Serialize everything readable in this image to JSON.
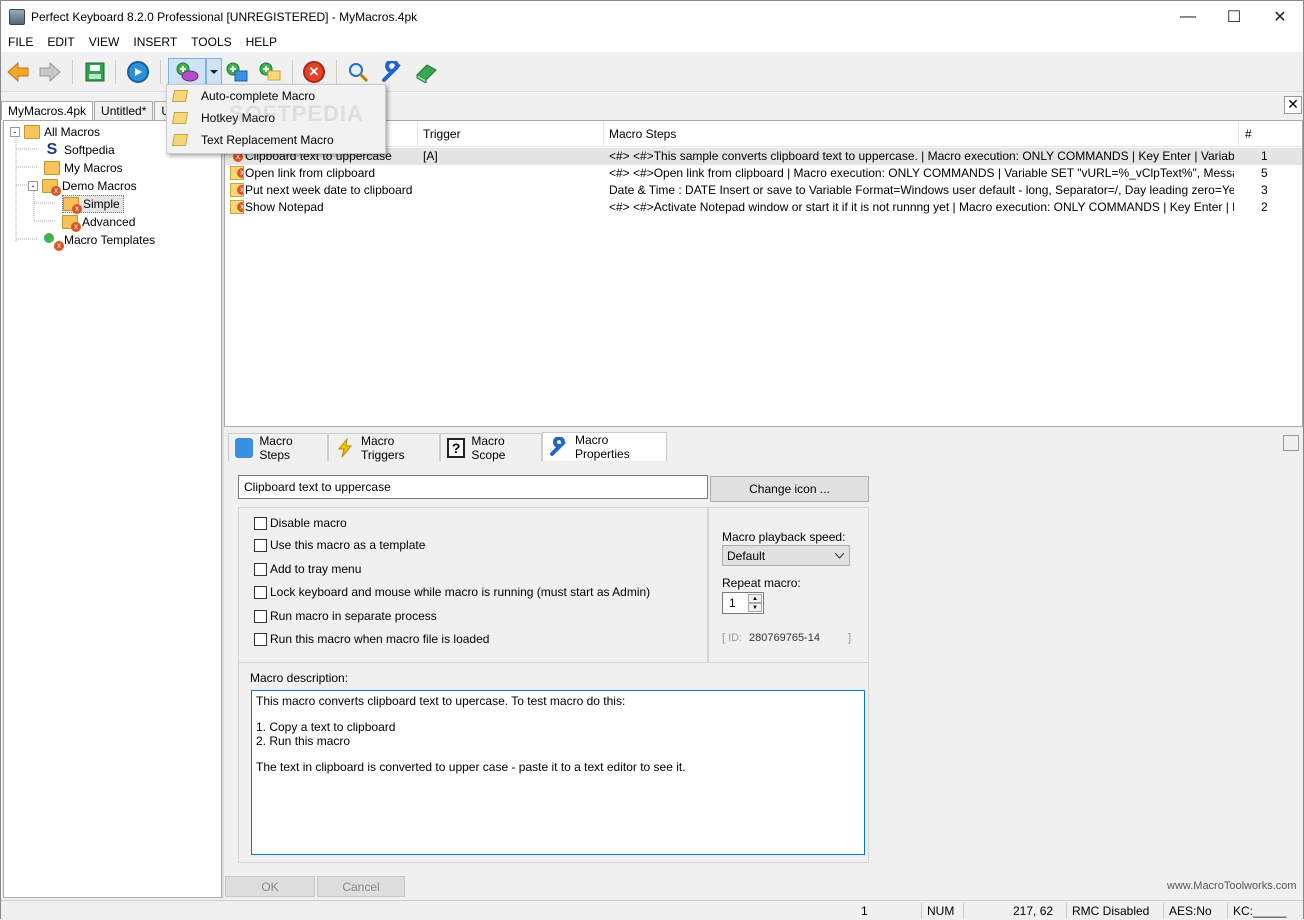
{
  "window": {
    "title": "Perfect Keyboard 8.2.0 Professional [UNREGISTERED] - MyMacros.4pk"
  },
  "menu": [
    "FILE",
    "EDIT",
    "VIEW",
    "INSERT",
    "TOOLS",
    "HELP"
  ],
  "doc_tabs": [
    "MyMacros.4pk",
    "Untitled*",
    "U"
  ],
  "dropdown": {
    "items": [
      "Auto-complete Macro",
      "Hotkey Macro",
      "Text Replacement Macro"
    ]
  },
  "tree": {
    "items": [
      {
        "label": "All Macros"
      },
      {
        "label": "Softpedia"
      },
      {
        "label": "My Macros"
      },
      {
        "label": "Demo Macros"
      },
      {
        "label": "Simple"
      },
      {
        "label": "Advanced"
      },
      {
        "label": "Macro Templates"
      }
    ]
  },
  "list": {
    "columns": [
      "Trigger",
      "Macro Steps",
      "#"
    ],
    "rows": [
      {
        "name": "Clipboard text to uppercase",
        "trigger": "[A]",
        "steps": "<#> <#>This sample converts clipboard text to uppercase. | Macro execution: ONLY COMMANDS | Key Enter | Variable OPERATI...",
        "count": "1"
      },
      {
        "name": "Open link from clipboard",
        "trigger": "",
        "steps": "<#> <#>Open link from clipboard | Macro execution: ONLY COMMANDS | Variable SET \"vURL=%_vClpText%\", Message text=\"<n...",
        "count": "5"
      },
      {
        "name": "Put next week date to clipboard",
        "trigger": "",
        "steps": "Date & Time : DATE Insert or save to Variable Format=Windows user default - long, Separator=/, Day leading zero=Yes, Month lea...",
        "count": "3"
      },
      {
        "name": "Show Notepad",
        "trigger": "",
        "steps": "<#> <#>Activate Notepad window or start it if it is not runnng yet | Macro execution: ONLY COMMANDS | Key Enter | Key Enter | IF...",
        "count": "2"
      }
    ]
  },
  "prop_tabs": [
    "Macro Steps",
    "Macro Triggers",
    "Macro Scope",
    "Macro Properties"
  ],
  "props": {
    "name_value": "Clipboard text to uppercase",
    "change_icon": "Change icon ...",
    "checks": [
      "Disable macro",
      "Use this macro as a template",
      "Add to tray menu",
      "Lock keyboard and mouse while macro is running (must start as Admin)",
      "Run macro in separate process",
      "Run this macro when macro file is loaded"
    ],
    "speed_label": "Macro playback speed:",
    "speed_value": "Default",
    "repeat_label": "Repeat macro:",
    "repeat_value": "1",
    "id_prefix": "[ ID:",
    "id_value": "280769765-14",
    "id_suffix": "]",
    "desc_label": "Macro description:",
    "desc_lines": [
      "This macro converts clipboard text to upercase. To test macro do this:",
      "",
      "1. Copy a text to clipboard",
      "2. Run this macro",
      "",
      "The text in clipboard is converted to upper case - paste it to a text editor to see it."
    ],
    "ok": "OK",
    "cancel": "Cancel",
    "website": "www.MacroToolworks.com"
  },
  "status": {
    "num1": "1",
    "num": "NUM",
    "coords": "217,  62",
    "rmc": "RMC Disabled",
    "aes": "AES:No",
    "kc": "KC:_____"
  },
  "watermark": "SOFTPEDIA"
}
